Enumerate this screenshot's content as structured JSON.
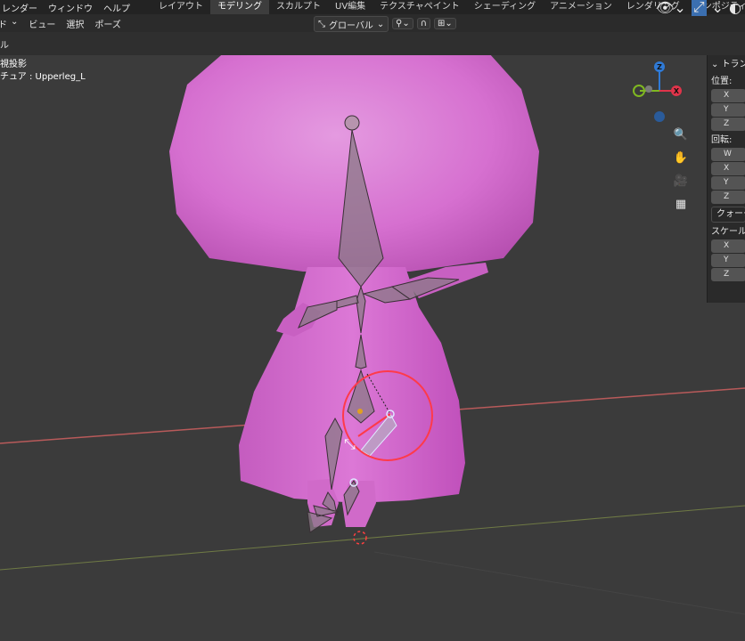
{
  "topbar": {
    "menu": [
      "レンダー",
      "ウィンドウ",
      "ヘルプ"
    ],
    "tabs": [
      "レイアウト",
      "モデリング",
      "スカルプト",
      "UV編集",
      "テクスチャペイント",
      "シェーディング",
      "アニメーション",
      "レンダリング",
      "コンポジティング"
    ],
    "active_tab": "モデリング"
  },
  "header": {
    "menu": [
      "ビュー",
      "選択",
      "ポーズ"
    ],
    "mode_fragment": "ド",
    "strip_fragment": "ル",
    "pivot_label": "グローバル"
  },
  "viewport": {
    "projection_label": "視投影",
    "active_bone_label": "チュア : Upperleg_L"
  },
  "gizmo": {
    "z_label": "Z",
    "x_label": "X",
    "colors": {
      "x": "#e0344a",
      "y": "#7fb821",
      "z": "#2f7ad6"
    }
  },
  "npanel": {
    "title": "トラン",
    "location_label": "位置:",
    "location_fields": [
      "X",
      "Y",
      "Z"
    ],
    "rotation_label": "回転:",
    "rotation_fields": [
      "W",
      "X",
      "Y",
      "Z"
    ],
    "rotation_mode": "クォータ",
    "scale_label": "スケール",
    "scale_fields": [
      "X",
      "Y",
      "Z"
    ]
  },
  "colors": {
    "mesh": "#d86ad0",
    "mesh_shadow": "#b84cb0",
    "bone": "#8a7a86",
    "selection_circle": "#ff3a4a",
    "x_axis_line": "#b85a5a",
    "y_axis_line": "#6f7a45"
  }
}
